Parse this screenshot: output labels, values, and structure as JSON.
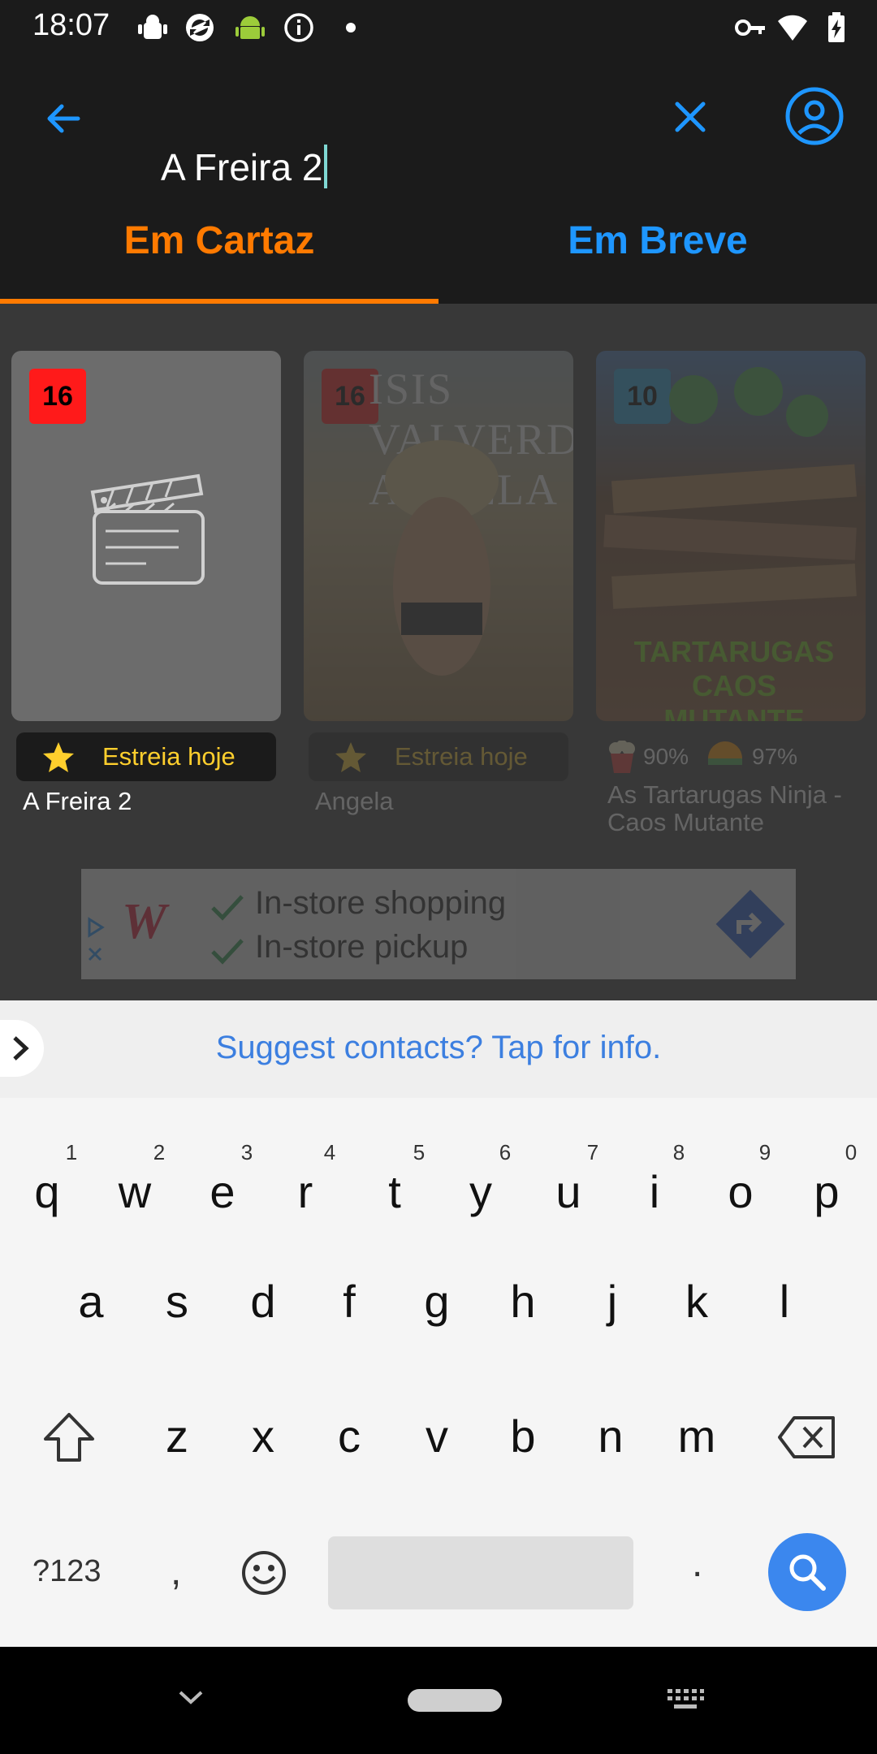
{
  "status_bar": {
    "time": "18:07",
    "icons": [
      "android-debug-icon",
      "sync-icon",
      "android-icon",
      "info-icon",
      "dot-icon",
      "vpn-key-icon",
      "wifi-icon",
      "battery-charging-icon"
    ]
  },
  "search": {
    "value": "A Freira 2",
    "back_icon": "arrow-back-icon",
    "clear_icon": "close-icon",
    "account_icon": "account-icon"
  },
  "tabs": [
    {
      "label": "Em Cartaz",
      "active": true
    },
    {
      "label": "Em Breve",
      "active": false
    }
  ],
  "colors": {
    "accent_orange": "#ff7a00",
    "accent_blue": "#1e96ff",
    "background": "#1b1b1b",
    "age_16": "#ff1a1a",
    "age_10": "#2aa6e0",
    "estreia_text": "#ffcf2d"
  },
  "movies": [
    {
      "title": "A Freira 2",
      "age": "16",
      "badge": "Estreia hoje",
      "poster": "clapperboard-icon"
    },
    {
      "title": "Angela",
      "age": "16",
      "badge": "Estreia hoje",
      "poster_text": "ISIS VALVERDE ANGELA"
    },
    {
      "title": "As Tartarugas Ninja - Caos Mutante",
      "age": "10",
      "rating_popcorn": "90%",
      "rating_audience": "97%",
      "poster_text": "TARTARUGAS CAOS MUTANTE"
    }
  ],
  "ad": {
    "line1": "In-store shopping",
    "line2": "In-store pickup"
  },
  "suggestion": {
    "text": "Suggest contacts? Tap for info."
  },
  "keyboard": {
    "row1": [
      {
        "key": "q",
        "hint": "1"
      },
      {
        "key": "w",
        "hint": "2"
      },
      {
        "key": "e",
        "hint": "3"
      },
      {
        "key": "r",
        "hint": "4"
      },
      {
        "key": "t",
        "hint": "5"
      },
      {
        "key": "y",
        "hint": "6"
      },
      {
        "key": "u",
        "hint": "7"
      },
      {
        "key": "i",
        "hint": "8"
      },
      {
        "key": "o",
        "hint": "9"
      },
      {
        "key": "p",
        "hint": "0"
      }
    ],
    "row2": [
      "a",
      "s",
      "d",
      "f",
      "g",
      "h",
      "j",
      "k",
      "l"
    ],
    "row3": [
      "z",
      "x",
      "c",
      "v",
      "b",
      "n",
      "m"
    ],
    "symbols_label": "?123",
    "comma": ",",
    "period": "."
  }
}
